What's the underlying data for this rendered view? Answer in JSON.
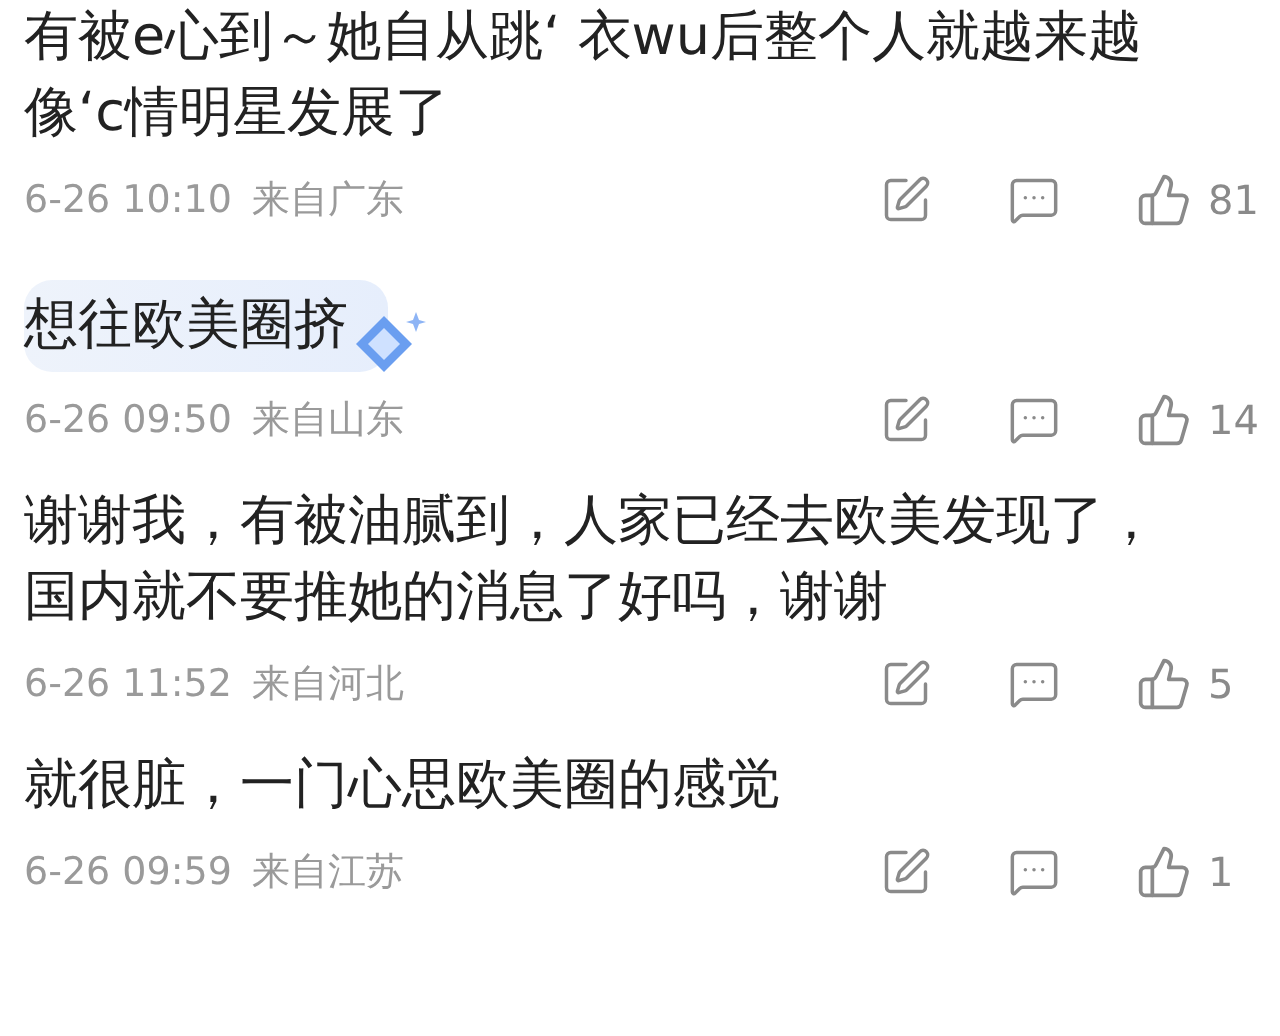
{
  "comments": [
    {
      "text": "有被e心到～她自从跳‘ 衣wu后整个人就越来越像‘c情明星发展了",
      "decorated": false,
      "date": "6-26 10:10",
      "location": "来自广东",
      "likes": "81"
    },
    {
      "text": "想往欧美圈挤",
      "decorated": true,
      "date": "6-26 09:50",
      "location": "来自山东",
      "likes": "14"
    },
    {
      "text": "谢谢我，有被油腻到，人家已经去欧美发现了，国内就不要推她的消息了好吗，谢谢",
      "decorated": false,
      "date": "6-26 11:52",
      "location": "来自河北",
      "likes": "5"
    },
    {
      "text": "就很脏，一门心思欧美圈的感觉",
      "decorated": false,
      "date": "6-26 09:59",
      "location": "来自江苏",
      "likes": "1"
    }
  ]
}
